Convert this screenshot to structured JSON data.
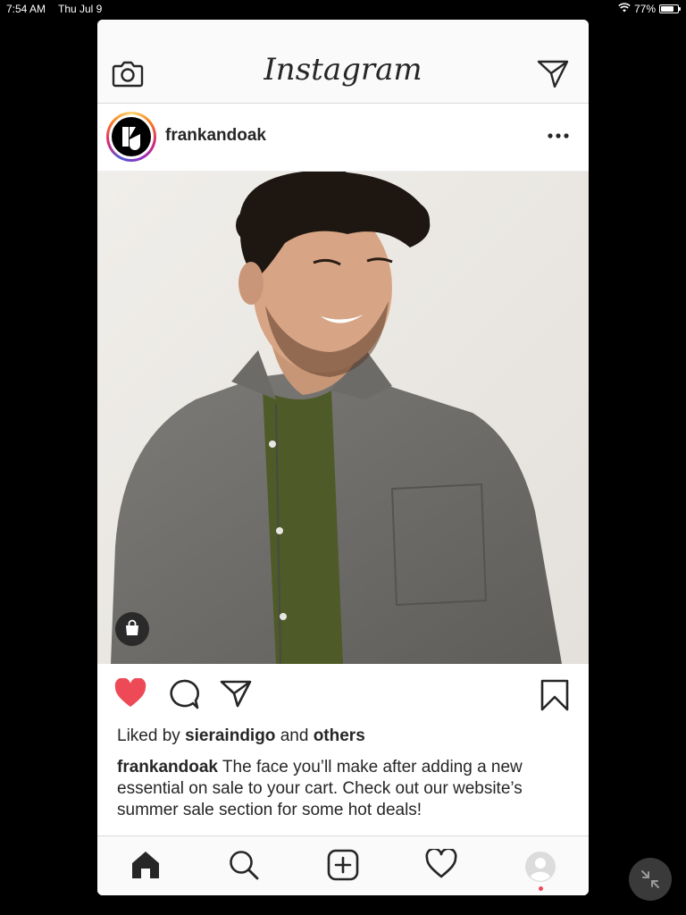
{
  "status_bar": {
    "time": "7:54 AM",
    "date": "Thu Jul 9",
    "battery": "77%",
    "battery_level": 0.77
  },
  "app": {
    "logo_text": "Instagram",
    "icons": {
      "camera": "camera-icon",
      "direct": "paper-plane-icon"
    }
  },
  "post": {
    "username": "frankandoak",
    "more_icon": "more-dots-icon",
    "photo_alt": "photo",
    "shopping_icon": "shopping-bag-icon",
    "liked": true,
    "like_color": "#ed4956",
    "likes_prefix": "Liked by",
    "likes_user": "sieraindigo",
    "likes_and": "and",
    "likes_others": "others",
    "caption_user": "frankandoak",
    "caption_text": "The face you’ll make after adding a new essential on sale to your cart. Check out our website’s summer sale section for some hot deals!"
  },
  "tab_bar": {
    "tabs": [
      "home-icon",
      "search-icon",
      "add-post-icon",
      "activity-heart-icon",
      "profile-avatar-icon"
    ],
    "notification_color": "#ed4956"
  }
}
